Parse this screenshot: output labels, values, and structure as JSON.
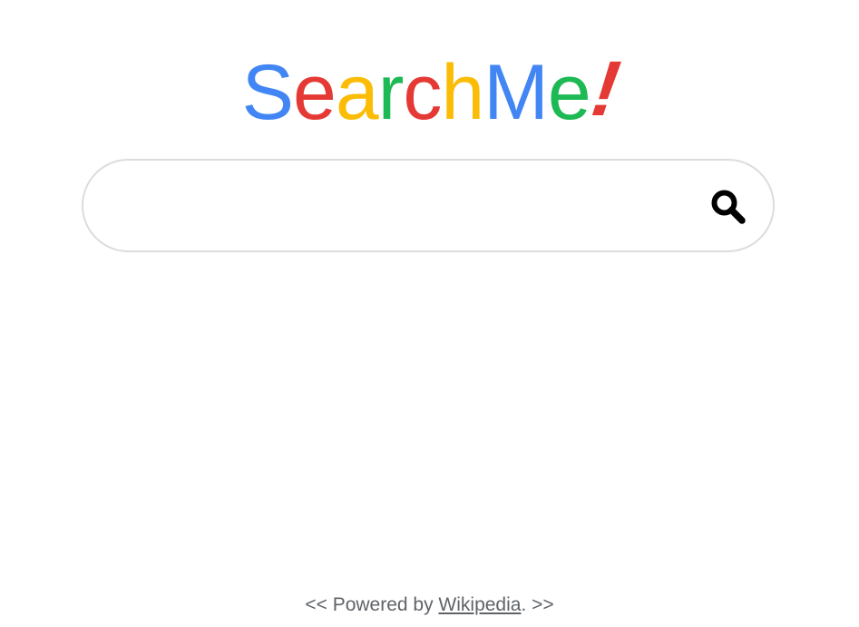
{
  "logo": {
    "letters": [
      {
        "char": "S",
        "color": "#4285f4"
      },
      {
        "char": "e",
        "color": "#e53935"
      },
      {
        "char": "a",
        "color": "#fbbc05"
      },
      {
        "char": "r",
        "color": "#1db954"
      },
      {
        "char": "c",
        "color": "#e53935"
      },
      {
        "char": "h",
        "color": "#fbbc05"
      },
      {
        "char": "M",
        "color": "#4285f4"
      },
      {
        "char": "e",
        "color": "#1db954"
      },
      {
        "char": "!",
        "color": "#e53935"
      }
    ]
  },
  "search": {
    "value": "",
    "placeholder": "",
    "button_icon": "search-icon"
  },
  "footer": {
    "prefix": "<< Powered by ",
    "link_text": "Wikipedia",
    "suffix": ". >>"
  }
}
